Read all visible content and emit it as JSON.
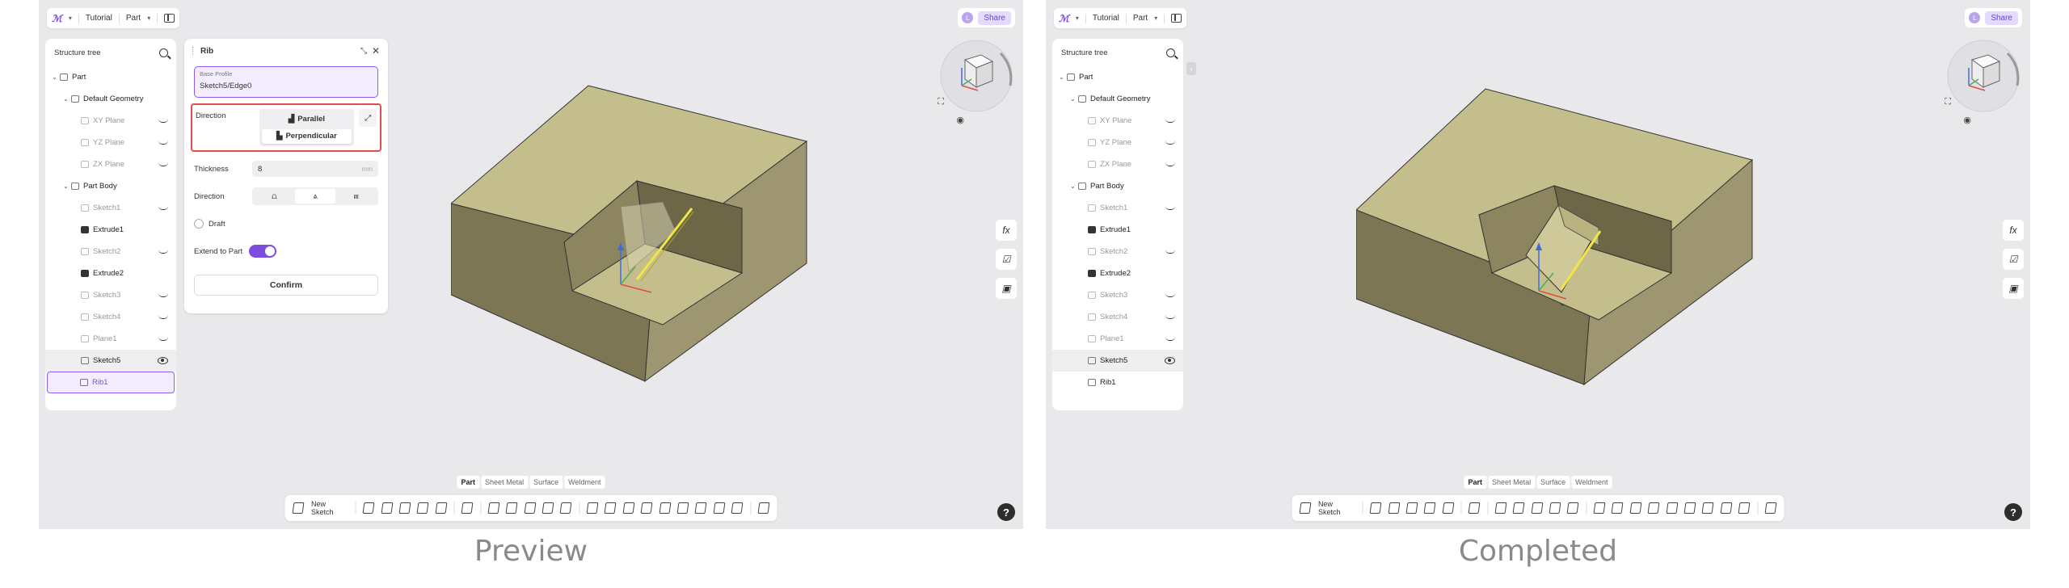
{
  "app": {
    "breadcrumb": [
      "Tutorial",
      "Part"
    ],
    "share_label": "Share",
    "avatar_letter": "L",
    "accent": "#7b4fd6"
  },
  "tree": {
    "title": "Structure tree",
    "items": [
      {
        "label": "Part"
      },
      {
        "label": "Default Geometry"
      },
      {
        "label": "XY Plane"
      },
      {
        "label": "YZ Plane"
      },
      {
        "label": "ZX Plane"
      },
      {
        "label": "Part Body"
      },
      {
        "label": "Sketch1"
      },
      {
        "label": "Extrude1"
      },
      {
        "label": "Sketch2"
      },
      {
        "label": "Extrude2"
      },
      {
        "label": "Sketch3"
      },
      {
        "label": "Sketch4"
      },
      {
        "label": "Plane1"
      },
      {
        "label": "Sketch5"
      },
      {
        "label": "Rib1"
      }
    ]
  },
  "rib": {
    "title": "Rib",
    "base_profile_label": "Base Profile",
    "base_profile_value": "Sketch5/Edge0",
    "direction_label": "Direction",
    "parallel_label": "Parallel",
    "perpendicular_label": "Perpendicular",
    "thickness_label": "Thickness",
    "thickness_value": "8",
    "thickness_unit": "mm",
    "direction2_label": "Direction",
    "draft_label": "Draft",
    "extend_label": "Extend to Part",
    "extend_on": true,
    "confirm_label": "Confirm"
  },
  "toolbar": {
    "tabs": [
      "Part",
      "Sheet Metal",
      "Surface",
      "Weldment"
    ],
    "new_sketch_label": "New Sketch"
  },
  "side": {
    "fx_label": "fx"
  },
  "help_label": "?",
  "captions": {
    "left": "Preview",
    "right": "Completed"
  }
}
